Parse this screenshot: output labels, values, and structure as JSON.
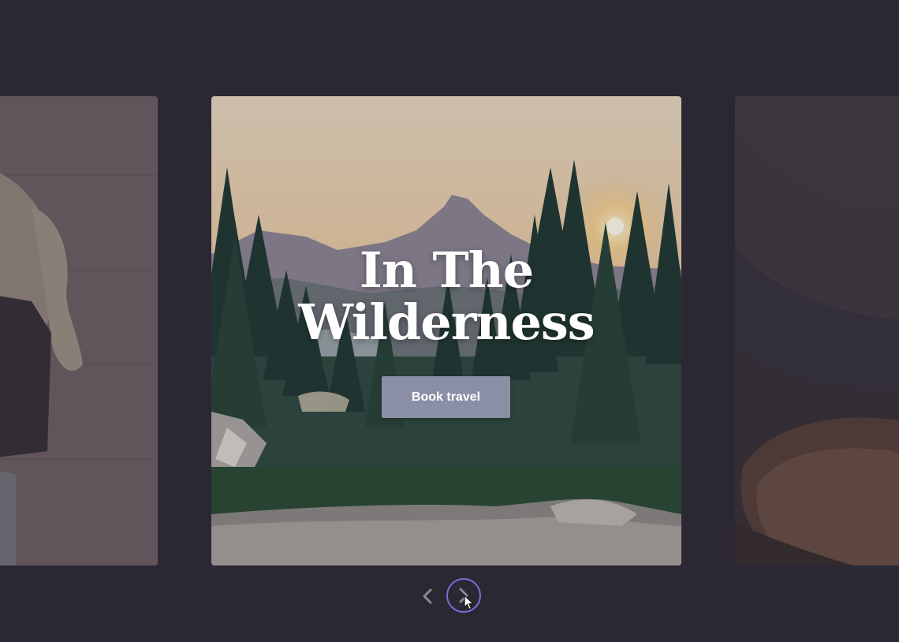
{
  "carousel": {
    "active_slide": {
      "title_line1": "In The",
      "title_line2": "Wilderness",
      "button_label": "Book travel"
    },
    "slides": [
      {
        "subject": "woman-portrait-photo"
      },
      {
        "subject": "mountain-forest-sunset-photo"
      },
      {
        "subject": "guitar-closeup-photo"
      }
    ]
  },
  "navigation": {
    "prev_icon": "chevron-left-icon",
    "next_icon": "chevron-right-icon"
  },
  "colors": {
    "background": "#2b2833",
    "button": "#8a8fa6",
    "focus_ring": "#7b6ee0"
  }
}
